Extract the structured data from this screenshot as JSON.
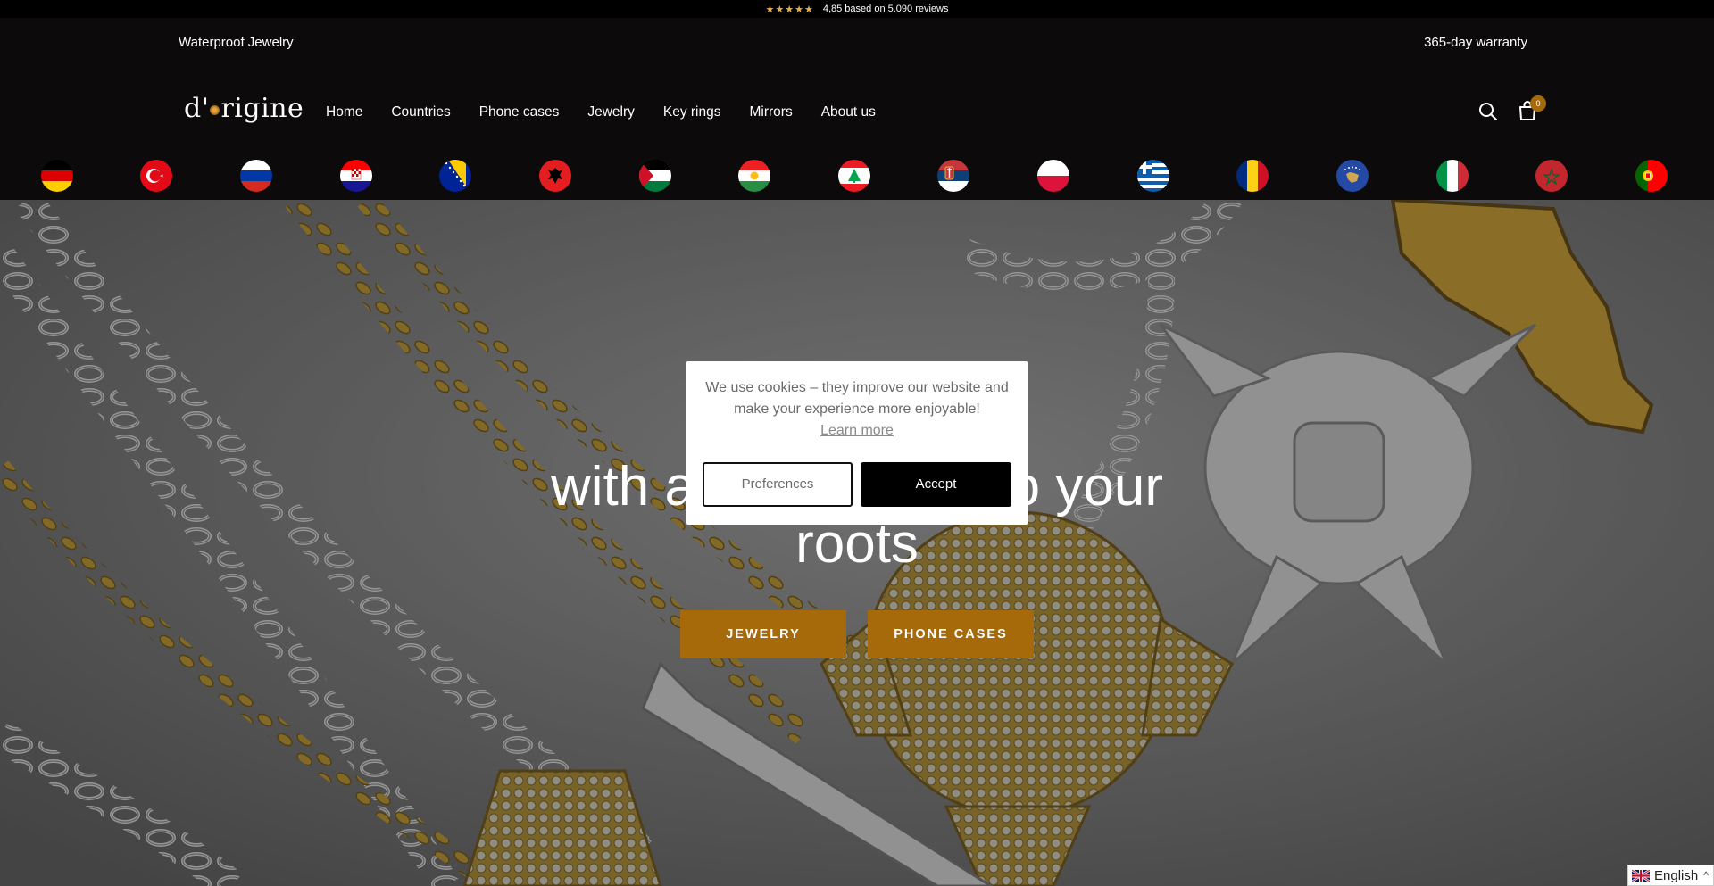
{
  "reviews": {
    "stars": "★★★★★",
    "text": "4,85 based on 5.090 reviews"
  },
  "announcement": {
    "left": "Waterproof Jewelry",
    "right": "365-day warranty"
  },
  "header": {
    "logo": {
      "prefix": "d'",
      "suffix": "rigine"
    },
    "nav": [
      "Home",
      "Countries",
      "Phone cases",
      "Jewelry",
      "Key rings",
      "Mirrors",
      "About us"
    ],
    "cart_count": "0"
  },
  "flags": [
    "germany-flag",
    "turkey-flag",
    "russia-flag",
    "croatia-flag",
    "bosnia-flag",
    "albania-flag",
    "palestine-flag",
    "kurdistan-flag",
    "lebanon-flag",
    "serbia-flag",
    "poland-flag",
    "greece-flag",
    "romania-flag",
    "kosovo-flag",
    "italy-flag",
    "morocco-flag",
    "portugal-flag"
  ],
  "hero": {
    "title_line1_left": "with a",
    "title_line1_right": "o your",
    "title_line2": "roots",
    "buttons": {
      "jewelry": "JEWELRY",
      "phone_cases": "PHONE CASES"
    }
  },
  "cookie": {
    "message": "We use cookies – they improve our website and make your experience more enjoyable!",
    "learn_more": "Learn more",
    "preferences": "Preferences",
    "accept": "Accept"
  },
  "language": {
    "label": "English",
    "chevron": "^"
  },
  "colors": {
    "accent": "#a66a0a",
    "header_bg": "#0c0a0b",
    "star": "#e6b43c"
  }
}
